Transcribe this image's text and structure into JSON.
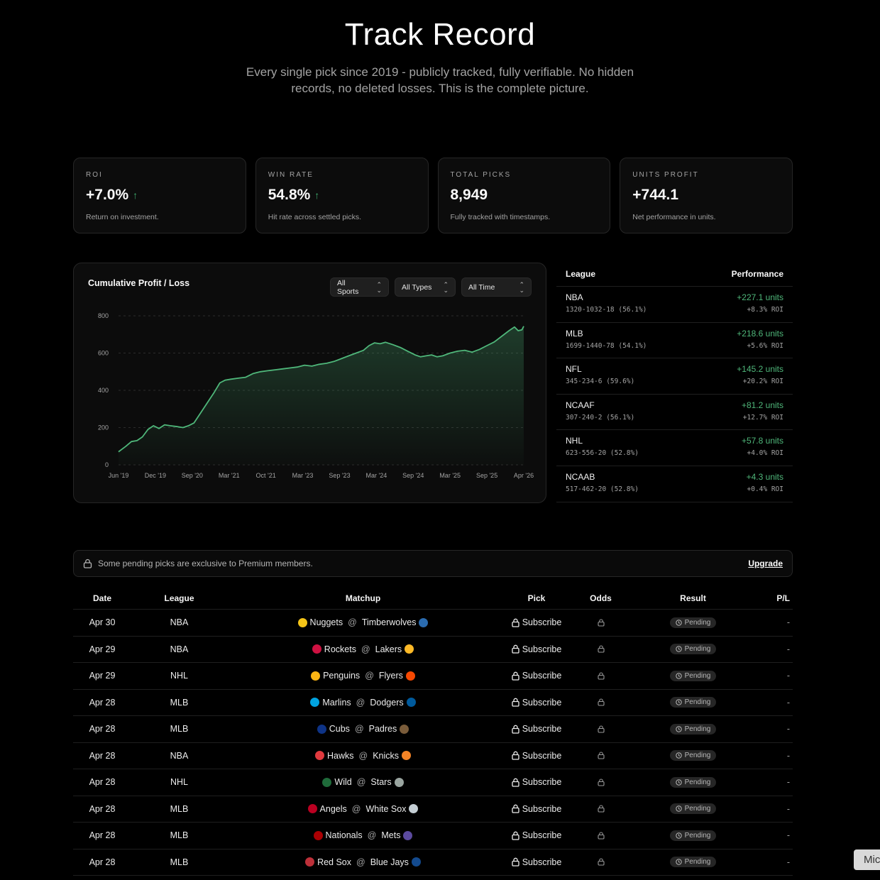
{
  "hero": {
    "title": "Track Record",
    "subtitle": "Every single pick since 2019 - publicly tracked, fully verifiable. No hidden records, no deleted losses. This is the complete picture."
  },
  "stats": [
    {
      "label": "ROI",
      "value": "+7.0%",
      "trend": "up",
      "desc": "Return on investment."
    },
    {
      "label": "WIN RATE",
      "value": "54.8%",
      "trend": "up",
      "desc": "Hit rate across settled picks."
    },
    {
      "label": "TOTAL PICKS",
      "value": "8,949",
      "trend": "",
      "desc": "Fully tracked with timestamps."
    },
    {
      "label": "UNITS PROFIT",
      "value": "+744.1",
      "trend": "",
      "desc": "Net performance in units."
    }
  ],
  "chart": {
    "title": "Cumulative Profit / Loss",
    "filters": [
      "All Sports",
      "All Types",
      "All Time"
    ]
  },
  "chart_data": {
    "type": "area",
    "title": "Cumulative Profit / Loss",
    "xlabel": "",
    "ylabel": "",
    "ylim": [
      0,
      800
    ],
    "yticks": [
      0,
      200,
      400,
      600,
      800
    ],
    "xticks": [
      "Jun '19",
      "Dec '19",
      "Sep '20",
      "Mar '21",
      "Oct '21",
      "Mar '23",
      "Sep '23",
      "Mar '24",
      "Sep '24",
      "Mar '25",
      "Sep '25",
      "Apr '26"
    ],
    "grid": true,
    "color": "#4fb77a",
    "series": [
      {
        "points": [
          [
            0,
            70
          ],
          [
            0.2,
            100
          ],
          [
            0.35,
            125
          ],
          [
            0.5,
            130
          ],
          [
            0.65,
            150
          ],
          [
            0.8,
            190
          ],
          [
            0.95,
            210
          ],
          [
            1.1,
            195
          ],
          [
            1.25,
            215
          ],
          [
            1.4,
            210
          ],
          [
            1.6,
            205
          ],
          [
            1.75,
            200
          ],
          [
            1.9,
            210
          ],
          [
            2.05,
            225
          ],
          [
            2.2,
            270
          ],
          [
            2.4,
            330
          ],
          [
            2.6,
            390
          ],
          [
            2.75,
            440
          ],
          [
            2.9,
            455
          ],
          [
            3.05,
            460
          ],
          [
            3.25,
            465
          ],
          [
            3.45,
            470
          ],
          [
            3.65,
            490
          ],
          [
            3.85,
            500
          ],
          [
            4.05,
            505
          ],
          [
            4.25,
            510
          ],
          [
            4.45,
            515
          ],
          [
            4.65,
            520
          ],
          [
            4.85,
            525
          ],
          [
            5.05,
            535
          ],
          [
            5.25,
            530
          ],
          [
            5.45,
            540
          ],
          [
            5.65,
            545
          ],
          [
            5.85,
            555
          ],
          [
            6.05,
            570
          ],
          [
            6.25,
            585
          ],
          [
            6.45,
            600
          ],
          [
            6.65,
            615
          ],
          [
            6.8,
            640
          ],
          [
            6.95,
            655
          ],
          [
            7.1,
            650
          ],
          [
            7.25,
            658
          ],
          [
            7.45,
            645
          ],
          [
            7.65,
            630
          ],
          [
            7.85,
            610
          ],
          [
            8.05,
            590
          ],
          [
            8.2,
            580
          ],
          [
            8.35,
            585
          ],
          [
            8.5,
            590
          ],
          [
            8.65,
            580
          ],
          [
            8.8,
            585
          ],
          [
            9.0,
            600
          ],
          [
            9.2,
            610
          ],
          [
            9.4,
            615
          ],
          [
            9.6,
            605
          ],
          [
            9.8,
            620
          ],
          [
            10.0,
            640
          ],
          [
            10.2,
            660
          ],
          [
            10.4,
            690
          ],
          [
            10.6,
            720
          ],
          [
            10.75,
            740
          ],
          [
            10.85,
            720
          ],
          [
            10.95,
            725
          ],
          [
            11.0,
            744
          ]
        ]
      }
    ]
  },
  "leagues": {
    "header_league": "League",
    "header_perf": "Performance",
    "rows": [
      {
        "name": "NBA",
        "record": "1320-1032-18 (56.1%)",
        "units": "+227.1 units",
        "roi": "+8.3% ROI"
      },
      {
        "name": "MLB",
        "record": "1699-1440-78 (54.1%)",
        "units": "+218.6 units",
        "roi": "+5.6% ROI"
      },
      {
        "name": "NFL",
        "record": "345-234-6 (59.6%)",
        "units": "+145.2 units",
        "roi": "+20.2% ROI"
      },
      {
        "name": "NCAAF",
        "record": "307-240-2 (56.1%)",
        "units": "+81.2 units",
        "roi": "+12.7% ROI"
      },
      {
        "name": "NHL",
        "record": "623-556-20 (52.8%)",
        "units": "+57.8 units",
        "roi": "+4.0% ROI"
      },
      {
        "name": "NCAAB",
        "record": "517-462-20 (52.8%)",
        "units": "+4.3 units",
        "roi": "+0.4% ROI"
      }
    ]
  },
  "notice": {
    "text": "Some pending picks are exclusive to Premium members.",
    "action": "Upgrade"
  },
  "table": {
    "headers": [
      "Date",
      "League",
      "Matchup",
      "Pick",
      "Odds",
      "Result",
      "P/L"
    ],
    "at": "@",
    "rows": [
      {
        "date": "Apr 30",
        "league": "NBA",
        "away": "Nuggets",
        "home": "Timberwolves",
        "away_color": "#f5c518",
        "home_color": "#2b6cb0",
        "pick": "Subscribe",
        "result": "Pending",
        "pl": "-"
      },
      {
        "date": "Apr 29",
        "league": "NBA",
        "away": "Rockets",
        "home": "Lakers",
        "away_color": "#ce1141",
        "home_color": "#fdb927",
        "pick": "Subscribe",
        "result": "Pending",
        "pl": "-"
      },
      {
        "date": "Apr 29",
        "league": "NHL",
        "away": "Penguins",
        "home": "Flyers",
        "away_color": "#fcb514",
        "home_color": "#f74902",
        "pick": "Subscribe",
        "result": "Pending",
        "pl": "-"
      },
      {
        "date": "Apr 28",
        "league": "MLB",
        "away": "Marlins",
        "home": "Dodgers",
        "away_color": "#00a3e0",
        "home_color": "#005a9c",
        "pick": "Subscribe",
        "result": "Pending",
        "pl": "-"
      },
      {
        "date": "Apr 28",
        "league": "MLB",
        "away": "Cubs",
        "home": "Padres",
        "away_color": "#0e3386",
        "home_color": "#7a5c3a",
        "pick": "Subscribe",
        "result": "Pending",
        "pl": "-"
      },
      {
        "date": "Apr 28",
        "league": "NBA",
        "away": "Hawks",
        "home": "Knicks",
        "away_color": "#e03a3e",
        "home_color": "#f58426",
        "pick": "Subscribe",
        "result": "Pending",
        "pl": "-"
      },
      {
        "date": "Apr 28",
        "league": "NHL",
        "away": "Wild",
        "home": "Stars",
        "away_color": "#1f6b3a",
        "home_color": "#9aa5a0",
        "pick": "Subscribe",
        "result": "Pending",
        "pl": "-"
      },
      {
        "date": "Apr 28",
        "league": "MLB",
        "away": "Angels",
        "home": "White Sox",
        "away_color": "#ba0021",
        "home_color": "#c4ced4",
        "pick": "Subscribe",
        "result": "Pending",
        "pl": "-"
      },
      {
        "date": "Apr 28",
        "league": "MLB",
        "away": "Nationals",
        "home": "Mets",
        "away_color": "#ab0003",
        "home_color": "#5b4a9e",
        "pick": "Subscribe",
        "result": "Pending",
        "pl": "-"
      },
      {
        "date": "Apr 28",
        "league": "MLB",
        "away": "Red Sox",
        "home": "Blue Jays",
        "away_color": "#bd3039",
        "home_color": "#134a8e",
        "pick": "Subscribe",
        "result": "Pending",
        "pl": "-"
      }
    ]
  },
  "mic_label": "Mic"
}
